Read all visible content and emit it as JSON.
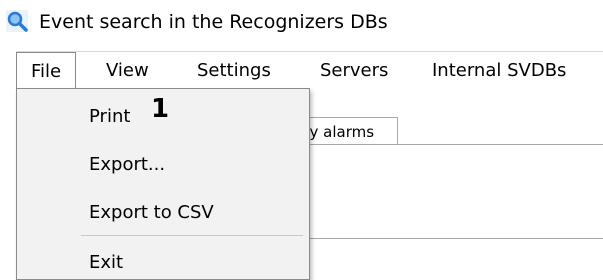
{
  "window": {
    "title": "Event search in the Recognizers DBs",
    "icon": "magnifier-icon"
  },
  "menubar": {
    "items": [
      {
        "label": "File",
        "active": true
      },
      {
        "label": "View"
      },
      {
        "label": "Settings"
      },
      {
        "label": "Servers"
      },
      {
        "label": "Internal SVDBs"
      }
    ]
  },
  "background_tab": {
    "label": "by alarms"
  },
  "file_menu": {
    "items": [
      {
        "label": "Print"
      },
      {
        "label": "Export..."
      },
      {
        "label": "Export to CSV"
      },
      {
        "label": "Exit"
      }
    ]
  },
  "annotation": {
    "callout": "1"
  },
  "colors": {
    "menu_background": "#f2f2f2",
    "menu_border": "#8a8a8a",
    "icon_accent": "#2b7bd6"
  }
}
